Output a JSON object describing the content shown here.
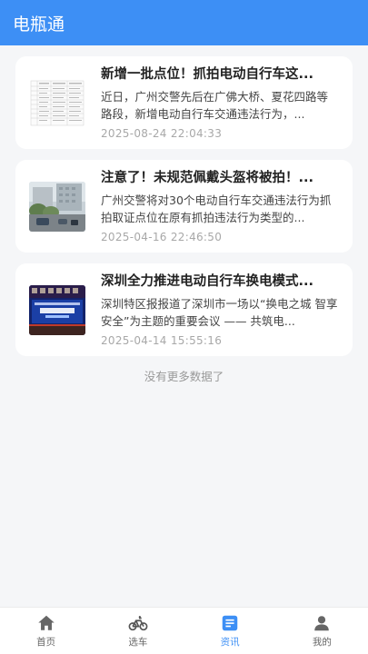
{
  "header": {
    "title": "电瓶通"
  },
  "articles": [
    {
      "title": "新增一批点位！抓拍电动自行车这...",
      "summary": "近日，广州交警先后在广佛大桥、夏花四路等路段，新增电动自行车交通违法行为，...",
      "date": "2025-08-24 22:04:33",
      "thumb_icon": "document-table-thumbnail"
    },
    {
      "title": "注意了！未规范佩戴头盔将被拍！...",
      "summary": "广州交警将对30个电动自行车交通违法行为抓拍取证点位在原有抓拍违法行为类型的...",
      "date": "2025-04-16 22:46:50",
      "thumb_icon": "street-photo-thumbnail"
    },
    {
      "title": "深圳全力推进电动自行车换电模式...",
      "summary": "深圳特区报报道了深圳市一场以“换电之城 智享安全”为主题的重要会议 —— 共筑电...",
      "date": "2025-04-14 15:55:16",
      "thumb_icon": "conference-stage-thumbnail"
    }
  ],
  "feed_end_text": "没有更多数据了",
  "tabbar": {
    "items": [
      {
        "label": "首页",
        "icon": "home-icon",
        "active": false
      },
      {
        "label": "选车",
        "icon": "bicycle-icon",
        "active": false
      },
      {
        "label": "资讯",
        "icon": "news-icon",
        "active": true
      },
      {
        "label": "我的",
        "icon": "user-icon",
        "active": false
      }
    ]
  },
  "colors": {
    "accent": "#3d8ff5",
    "background": "#f5f6f8",
    "inactive_tab": "#666666"
  }
}
